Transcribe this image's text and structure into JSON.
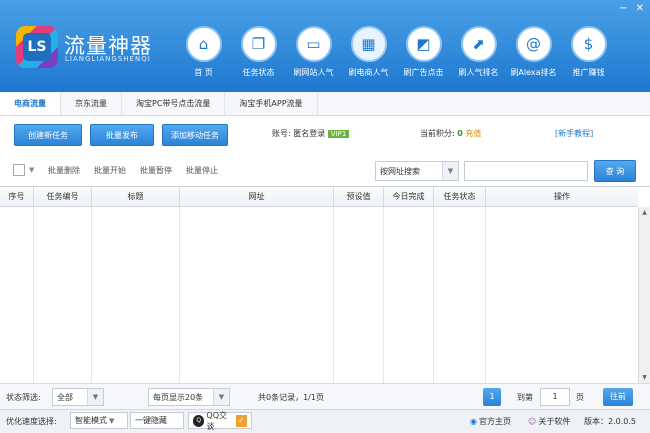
{
  "window": {
    "min": "−",
    "close": "✕"
  },
  "brand": {
    "logo_text": "LS",
    "name_cn": "流量神器",
    "name_en": "LIANGLIANGSHENQI"
  },
  "nav": [
    {
      "label": "首 页",
      "icon": "⌂",
      "icon_name": "home-icon"
    },
    {
      "label": "任务状态",
      "icon": "❐",
      "icon_name": "tasks-icon"
    },
    {
      "label": "刷网站人气",
      "icon": "▭",
      "icon_name": "monitor-icon"
    },
    {
      "label": "刷电商人气",
      "icon": "▦",
      "icon_name": "shop-icon"
    },
    {
      "label": "刷广告点击",
      "icon": "◩",
      "icon_name": "ad-icon"
    },
    {
      "label": "刷人气排名",
      "icon": "⬈",
      "icon_name": "chart-icon"
    },
    {
      "label": "刷Alexa排名",
      "icon": "@",
      "icon_name": "alexa-icon"
    },
    {
      "label": "推广赚钱",
      "icon": "$",
      "icon_name": "money-bag-icon"
    }
  ],
  "tabs": [
    "电商流量",
    "京东流量",
    "淘宝PC带号点击流量",
    "淘宝手机APP流量"
  ],
  "toolbar": {
    "create": "创建新任务",
    "batch_publish": "批量发布",
    "add_task": "添加移动任务",
    "account_label": "账号:",
    "account_name": "匿名登录",
    "vip": "VIP1",
    "points_label": "当前积分:",
    "points_value": "0",
    "recharge": "充值",
    "tutorial": "[新手教程]"
  },
  "toolbar2": {
    "batch_delete": "批量删除",
    "batch_start": "批量开始",
    "batch_pause": "批量暂停",
    "batch_stop": "批量停止",
    "search_type": "按网址搜索",
    "search_btn": "查 询"
  },
  "grid": {
    "columns": [
      "序号",
      "任务编号",
      "标题",
      "网址",
      "预设值",
      "今日完成",
      "任务状态",
      "操作"
    ]
  },
  "pager": {
    "status_label": "状态筛选:",
    "status_value": "全部",
    "page_size": "每页显示20条",
    "summary": "共0条记录，1/1页",
    "current_page": "1",
    "goto_label": "到第",
    "goto_value": "1",
    "page_unit": "页",
    "go_btn": "往前"
  },
  "statusbar": {
    "speed_label": "优化速度选择:",
    "speed_value": "智能模式",
    "hide": "一键隐藏",
    "qq": "QQ交谈",
    "homepage": "官方主页",
    "about": "关于软件",
    "version": "版本：2.0.0.5"
  }
}
